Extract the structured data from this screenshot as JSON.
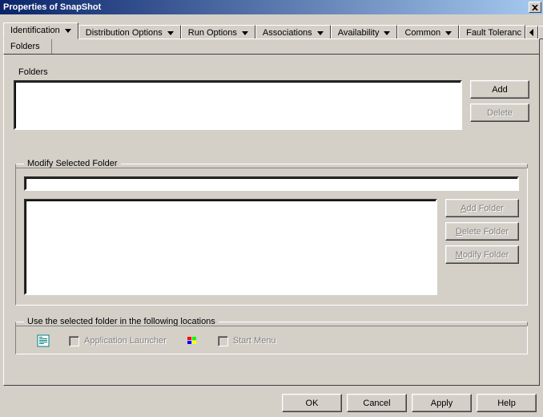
{
  "window": {
    "title": "Properties of SnapShot"
  },
  "tabs": {
    "items": [
      {
        "label": "Identification",
        "active": true
      },
      {
        "label": "Distribution Options"
      },
      {
        "label": "Run Options"
      },
      {
        "label": "Associations"
      },
      {
        "label": "Availability"
      },
      {
        "label": "Common"
      },
      {
        "label": "Fault Toleranc"
      }
    ],
    "subtab": "Folders"
  },
  "folders": {
    "heading": "Folders",
    "add": "Add",
    "delete": "Delete"
  },
  "modify": {
    "legend": "Modify Selected Folder",
    "add_folder": "Add Folder",
    "delete_folder": "Delete Folder",
    "modify_folder": "Modify Folder"
  },
  "locations": {
    "legend": "Use the selected folder in the following locations",
    "app_launcher": "Application Launcher",
    "start_menu": "Start Menu"
  },
  "buttons": {
    "ok": "OK",
    "cancel": "Cancel",
    "apply": "Apply",
    "help": "Help"
  }
}
